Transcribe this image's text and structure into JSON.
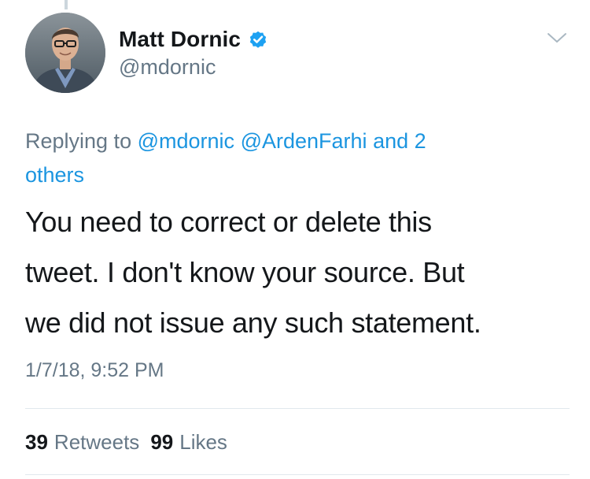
{
  "tweet": {
    "author": {
      "display_name": "Matt Dornic",
      "handle": "@mdornic",
      "verified": true
    },
    "replying": {
      "prefix": "Replying to",
      "mentions": [
        "@mdornic",
        "@ArdenFarhi"
      ],
      "connector": "and 2",
      "others": "others"
    },
    "text_lines": [
      "You need to correct or delete this",
      "tweet. I don't know your source. But",
      "we did not issue any such statement."
    ],
    "timestamp": "1/7/18, 9:52 PM",
    "stats": {
      "retweets_count": "39",
      "retweets_label": "Retweets",
      "likes_count": "99",
      "likes_label": "Likes"
    }
  },
  "icons": {
    "verified": "verified-badge-icon",
    "caret": "chevron-down-icon"
  },
  "colors": {
    "link": "#1b95e0",
    "secondary_text": "#657786",
    "primary_text": "#14171a",
    "divider": "#e1e8ed",
    "verified_badge": "#1da1f2"
  }
}
